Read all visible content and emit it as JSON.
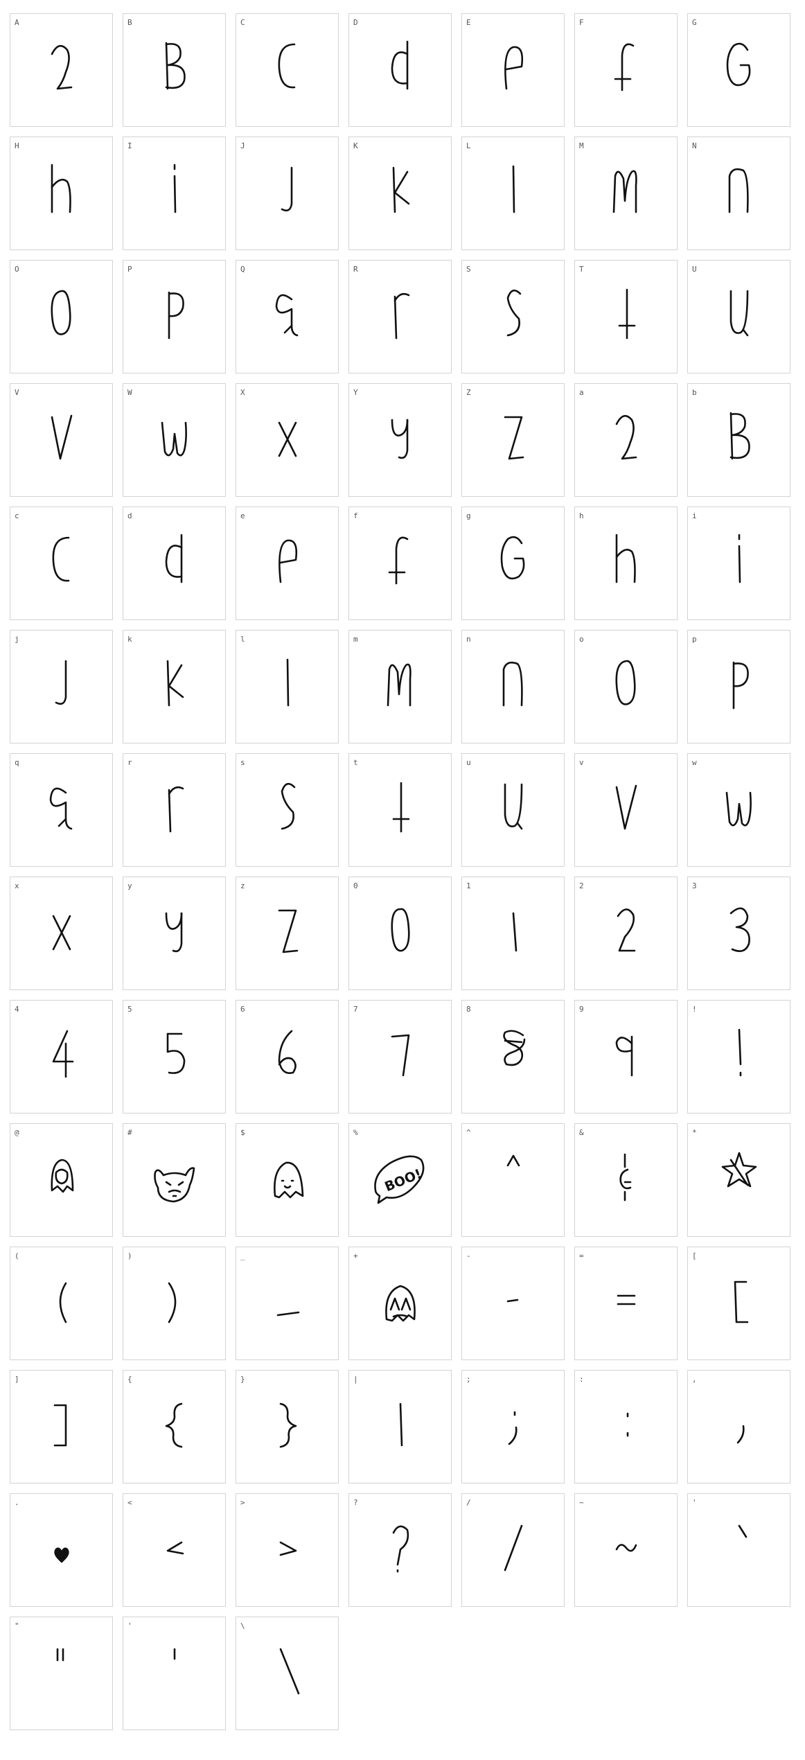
{
  "specimen": {
    "colors": {
      "background": "#ffffff",
      "cell_border": "#d3d3d3",
      "label": "#555555",
      "ink": "#111111"
    },
    "cells": [
      {
        "label": "A",
        "glyph": "a"
      },
      {
        "label": "B",
        "glyph": "B"
      },
      {
        "label": "C",
        "glyph": "C"
      },
      {
        "label": "D",
        "glyph": "d"
      },
      {
        "label": "E",
        "glyph": "e"
      },
      {
        "label": "F",
        "glyph": "f"
      },
      {
        "label": "G",
        "glyph": "G"
      },
      {
        "label": "H",
        "glyph": "h"
      },
      {
        "label": "I",
        "glyph": "i"
      },
      {
        "label": "J",
        "glyph": "J"
      },
      {
        "label": "K",
        "glyph": "K"
      },
      {
        "label": "L",
        "glyph": "l"
      },
      {
        "label": "M",
        "glyph": "M"
      },
      {
        "label": "N",
        "glyph": "N"
      },
      {
        "label": "O",
        "glyph": "O"
      },
      {
        "label": "P",
        "glyph": "P"
      },
      {
        "label": "Q",
        "glyph": "q"
      },
      {
        "label": "R",
        "glyph": "r"
      },
      {
        "label": "S",
        "glyph": "S"
      },
      {
        "label": "T",
        "glyph": "t"
      },
      {
        "label": "U",
        "glyph": "U"
      },
      {
        "label": "V",
        "glyph": "V"
      },
      {
        "label": "W",
        "glyph": "W"
      },
      {
        "label": "X",
        "glyph": "X"
      },
      {
        "label": "Y",
        "glyph": "y"
      },
      {
        "label": "Z",
        "glyph": "Z"
      },
      {
        "label": "a",
        "glyph": "a"
      },
      {
        "label": "b",
        "glyph": "B"
      },
      {
        "label": "c",
        "glyph": "C"
      },
      {
        "label": "d",
        "glyph": "d"
      },
      {
        "label": "e",
        "glyph": "e"
      },
      {
        "label": "f",
        "glyph": "f"
      },
      {
        "label": "g",
        "glyph": "G"
      },
      {
        "label": "h",
        "glyph": "h"
      },
      {
        "label": "i",
        "glyph": "i"
      },
      {
        "label": "j",
        "glyph": "J"
      },
      {
        "label": "k",
        "glyph": "K"
      },
      {
        "label": "l",
        "glyph": "l"
      },
      {
        "label": "m",
        "glyph": "M"
      },
      {
        "label": "n",
        "glyph": "N"
      },
      {
        "label": "o",
        "glyph": "O"
      },
      {
        "label": "p",
        "glyph": "P"
      },
      {
        "label": "q",
        "glyph": "q"
      },
      {
        "label": "r",
        "glyph": "r"
      },
      {
        "label": "s",
        "glyph": "S"
      },
      {
        "label": "t",
        "glyph": "t"
      },
      {
        "label": "u",
        "glyph": "U"
      },
      {
        "label": "v",
        "glyph": "V"
      },
      {
        "label": "w",
        "glyph": "W"
      },
      {
        "label": "x",
        "glyph": "X"
      },
      {
        "label": "y",
        "glyph": "y"
      },
      {
        "label": "z",
        "glyph": "Z"
      },
      {
        "label": "0",
        "glyph": "0"
      },
      {
        "label": "1",
        "glyph": "1"
      },
      {
        "label": "2",
        "glyph": "2"
      },
      {
        "label": "3",
        "glyph": "3"
      },
      {
        "label": "4",
        "glyph": "4"
      },
      {
        "label": "5",
        "glyph": "5"
      },
      {
        "label": "6",
        "glyph": "6"
      },
      {
        "label": "7",
        "glyph": "7"
      },
      {
        "label": "8",
        "glyph": "8"
      },
      {
        "label": "9",
        "glyph": "9"
      },
      {
        "label": "!",
        "glyph": "!"
      },
      {
        "label": "@",
        "glyph": "ghost-small-icon"
      },
      {
        "label": "#",
        "glyph": "devil-face-icon"
      },
      {
        "label": "$",
        "glyph": "ghost-icon"
      },
      {
        "label": "%",
        "glyph": "boo-bubble-icon"
      },
      {
        "label": "^",
        "glyph": "^"
      },
      {
        "label": "&",
        "glyph": "&"
      },
      {
        "label": "*",
        "glyph": "star-icon"
      },
      {
        "label": "(",
        "glyph": "("
      },
      {
        "label": ")",
        "glyph": ")"
      },
      {
        "label": "_",
        "glyph": "_"
      },
      {
        "label": "+",
        "glyph": "ghost-sad-icon"
      },
      {
        "label": "-",
        "glyph": "-"
      },
      {
        "label": "=",
        "glyph": "="
      },
      {
        "label": "[",
        "glyph": "["
      },
      {
        "label": "]",
        "glyph": "]"
      },
      {
        "label": "{",
        "glyph": "{"
      },
      {
        "label": "}",
        "glyph": "}"
      },
      {
        "label": "|",
        "glyph": "|"
      },
      {
        "label": ";",
        "glyph": ";"
      },
      {
        "label": ":",
        "glyph": ":"
      },
      {
        "label": ",",
        "glyph": ","
      },
      {
        "label": ".",
        "glyph": "heart-icon"
      },
      {
        "label": "<",
        "glyph": "<"
      },
      {
        "label": ">",
        "glyph": ">"
      },
      {
        "label": "?",
        "glyph": "?"
      },
      {
        "label": "/",
        "glyph": "/"
      },
      {
        "label": "~",
        "glyph": "~"
      },
      {
        "label": "'",
        "glyph": "grave"
      },
      {
        "label": "\"",
        "glyph": "dquote"
      },
      {
        "label": "'",
        "glyph": "quote"
      },
      {
        "label": "\\",
        "glyph": "backslash"
      }
    ],
    "boo_text": "BOO!"
  }
}
